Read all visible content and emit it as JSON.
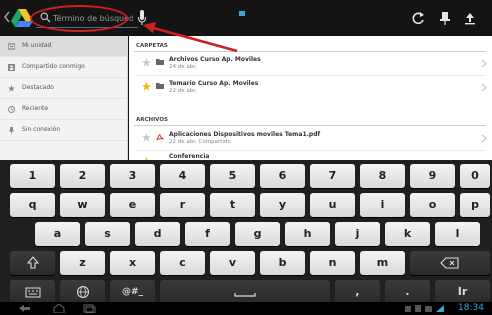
{
  "topbar": {
    "search_placeholder": "Término de búsqueda",
    "icons": [
      "back-chevron-icon",
      "drive-logo",
      "search-icon",
      "microphone-icon",
      "refresh-icon",
      "pin-icon",
      "upload-icon"
    ]
  },
  "drawer": {
    "items": [
      {
        "label": "Mi unidad",
        "icon": "drive-folder-icon",
        "active": true
      },
      {
        "label": "Compartido conmigo",
        "icon": "shared-icon",
        "active": false
      },
      {
        "label": "Destacado",
        "icon": "star-icon",
        "active": false
      },
      {
        "label": "Reciente",
        "icon": "clock-icon",
        "active": false
      },
      {
        "label": "Sin conexión",
        "icon": "pin-icon",
        "active": false
      }
    ]
  },
  "main": {
    "folders_header": "CARPETAS",
    "files_header": "ARCHIVOS",
    "folders": [
      {
        "name": "Archivos Curso Ap. Moviles",
        "date": "24 de abr.",
        "starred": false
      },
      {
        "name": "Temario Curso Ap. Moviles",
        "date": "22 de abr.",
        "starred": true
      }
    ],
    "files": [
      {
        "name": "Aplicaciones Dispositivos moviles Tema1.pdf",
        "date": "22 de abr.  Compartido",
        "type": "pdf",
        "starred": false
      },
      {
        "name": "Conferencia",
        "date": "",
        "type": "doc",
        "starred": true
      }
    ]
  },
  "keyboard": {
    "row1": [
      "1",
      "2",
      "3",
      "4",
      "5",
      "6",
      "7",
      "8",
      "9",
      "0"
    ],
    "row2": [
      "q",
      "w",
      "e",
      "r",
      "t",
      "y",
      "u",
      "i",
      "o",
      "p"
    ],
    "row3": [
      "a",
      "s",
      "d",
      "f",
      "g",
      "h",
      "j",
      "k",
      "l"
    ],
    "row4": [
      "z",
      "x",
      "c",
      "v",
      "b",
      "n",
      "m"
    ],
    "row2_sub": [
      "",
      "",
      "",
      "",
      "",
      "",
      "",
      "",
      "",
      ""
    ],
    "row3_sub": [
      "",
      "",
      "",
      "",
      "",
      "",
      "",
      "",
      ""
    ],
    "row4_sub": [
      "",
      "",
      "",
      "",
      "",
      "",
      ""
    ],
    "symbols_label": "@#_",
    "go_label": "Ir",
    "comma": ",",
    "period": "."
  },
  "statusbar": {
    "clock": "18:34"
  },
  "colors": {
    "accent": "#3aa6dd",
    "annotation": "#d01f1f",
    "star": "#f5b400",
    "pdf": "#d93b2b"
  }
}
